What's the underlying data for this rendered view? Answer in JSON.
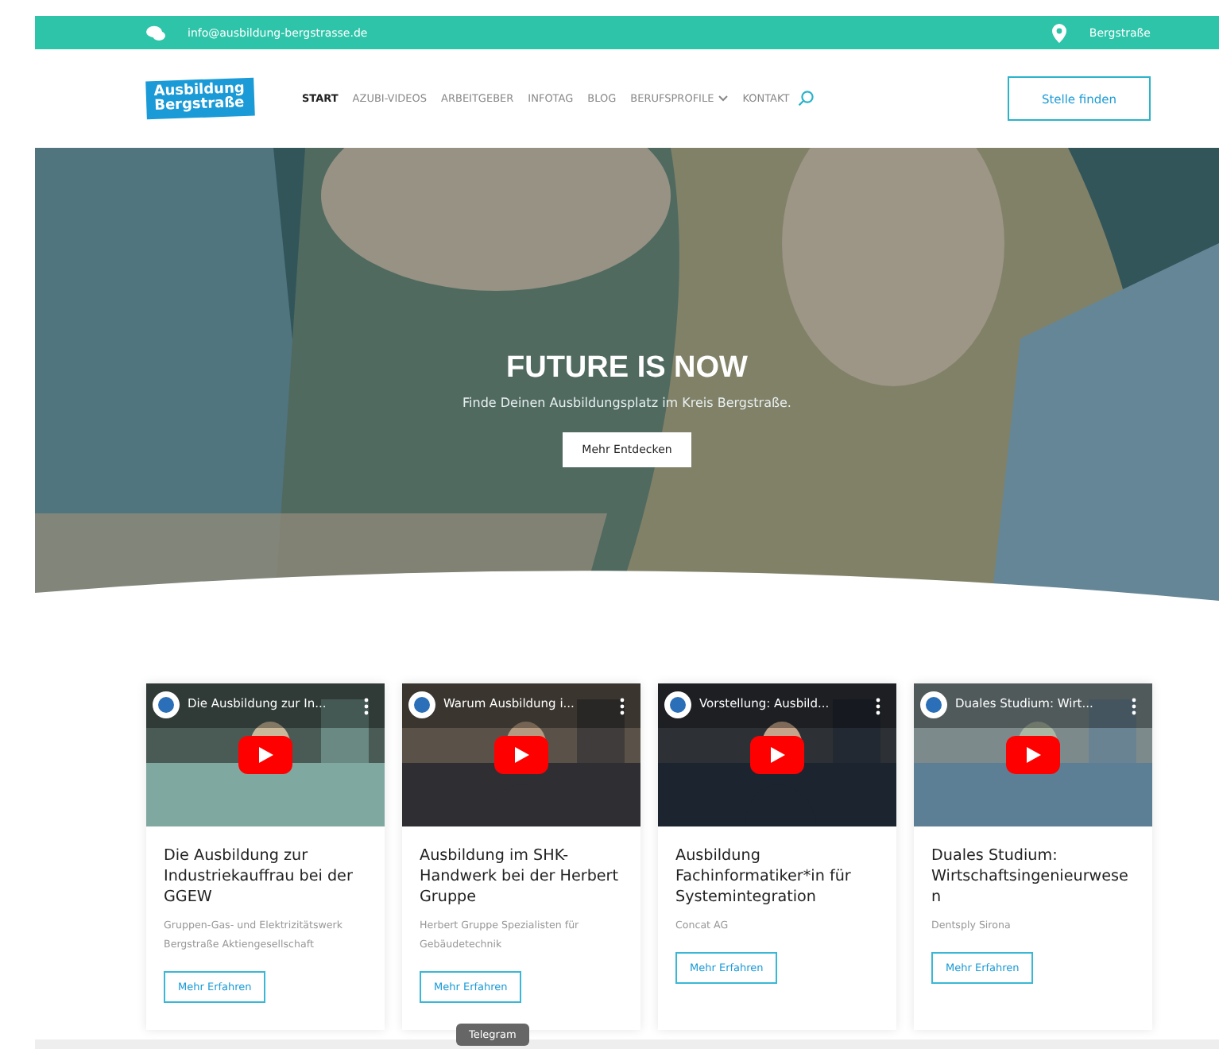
{
  "topbar": {
    "email": "info@ausbildung-bergstrasse.de",
    "location": "Bergstraße"
  },
  "logo": {
    "line_1": "Ausbildung",
    "line_2": "Bergstraße"
  },
  "nav": [
    {
      "label": "START",
      "selected": true,
      "dropdown": false
    },
    {
      "label": "AZUBI-VIDEOS",
      "selected": false,
      "dropdown": false
    },
    {
      "label": "ARBEITGEBER",
      "selected": false,
      "dropdown": false
    },
    {
      "label": "INFOTAG",
      "selected": false,
      "dropdown": false
    },
    {
      "label": "BLOG",
      "selected": false,
      "dropdown": false
    },
    {
      "label": "BERUFSPROFILE",
      "selected": false,
      "dropdown": true
    },
    {
      "label": "KONTAKT",
      "selected": false,
      "dropdown": false
    }
  ],
  "header_button": "Stelle finden",
  "hero": {
    "title": "FUTURE IS NOW",
    "subtitle": "Finde Deinen Ausbildungsplatz im Kreis Bergstraße.",
    "button": "Mehr Entdecken"
  },
  "cards": [
    {
      "video_title": "Die Ausbildung zur In...",
      "title": "Die Ausbildung zur Industriekauffrau bei der GGEW",
      "company": "Gruppen-Gas- und Elektrizitätswerk Bergstraße Aktiengesellschaft",
      "button": "Mehr Erfahren"
    },
    {
      "video_title": "Warum Ausbildung i...",
      "title": "Ausbildung im SHK-Handwerk bei der Herbert Gruppe",
      "company": "Herbert Gruppe Spezialisten für Gebäudetechnik",
      "button": "Mehr Erfahren"
    },
    {
      "video_title": "Vorstellung: Ausbild...",
      "title": "Ausbildung Fachinformatiker*in für Systemintegration",
      "company": "Concat AG",
      "button": "Mehr Erfahren"
    },
    {
      "video_title": "Duales Studium: Wirt...",
      "title": "Duales Studium: Wirtschaftsingenieurwesen",
      "company": "Dentsply Sirona",
      "button": "Mehr Erfahren"
    }
  ],
  "tooltip": "Telegram"
}
